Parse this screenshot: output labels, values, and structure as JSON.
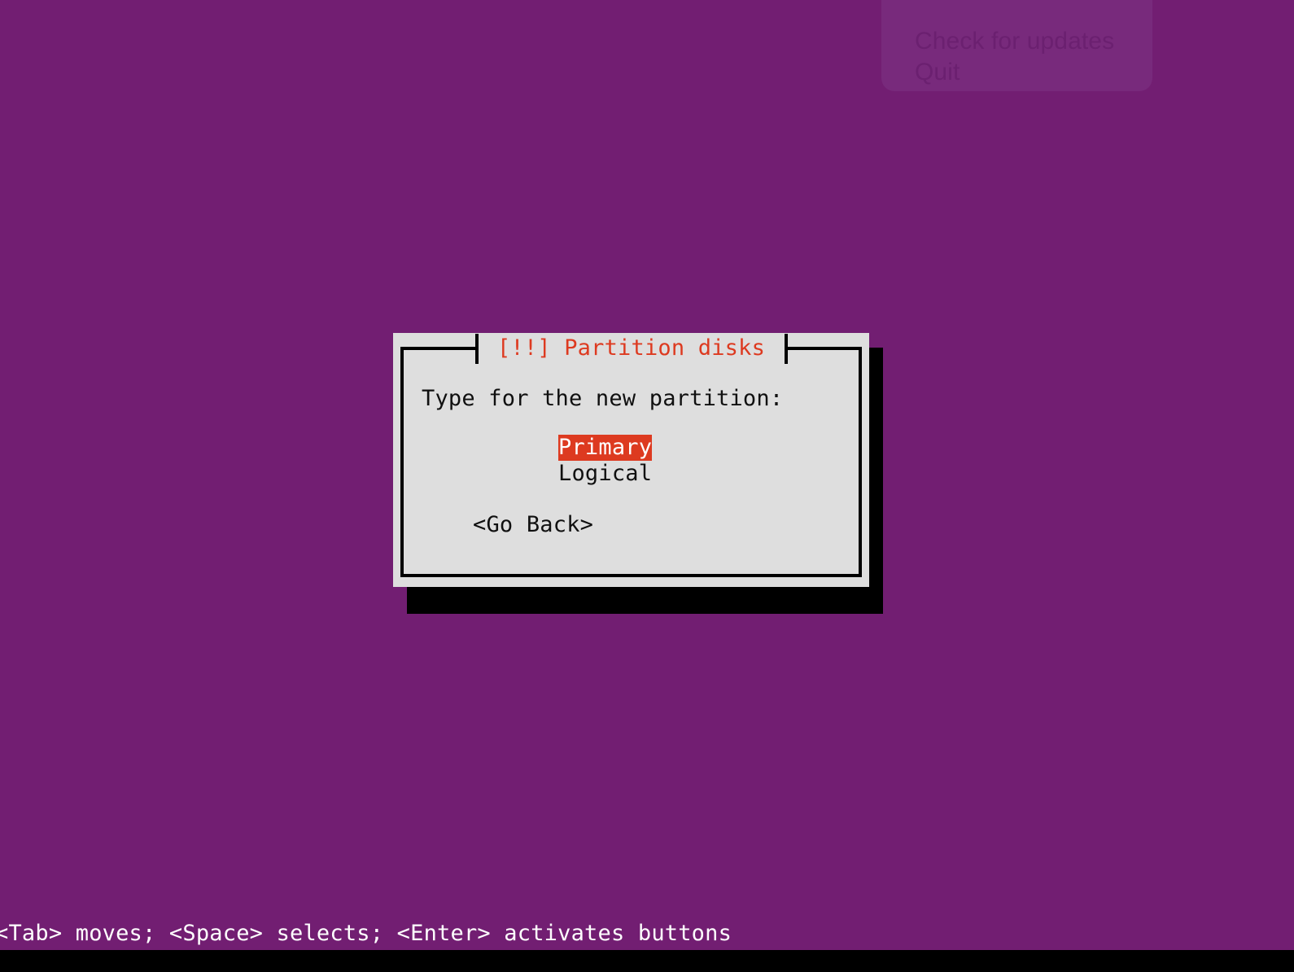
{
  "screen": {
    "background_color": "#721e72"
  },
  "ghost_menu": {
    "panel_color": "#782a7c",
    "text_color": "#6b2070",
    "items": [
      {
        "label": "Check for updates"
      },
      {
        "label": "Quit"
      }
    ]
  },
  "dialog": {
    "title": "[!!] Partition disks",
    "title_color": "#dd3a20",
    "background_color": "#dedede",
    "border_color": "#000000",
    "prompt": "Type for the new partition:",
    "choices": [
      {
        "label": "Primary",
        "selected": true
      },
      {
        "label": "Logical",
        "selected": false
      }
    ],
    "selected_color": "#dd3a20",
    "buttons": [
      {
        "label": "<Go Back>"
      }
    ]
  },
  "status_bar": {
    "text": "<Tab> moves; <Space> selects; <Enter> activates buttons",
    "text_color": "#ffffff"
  }
}
